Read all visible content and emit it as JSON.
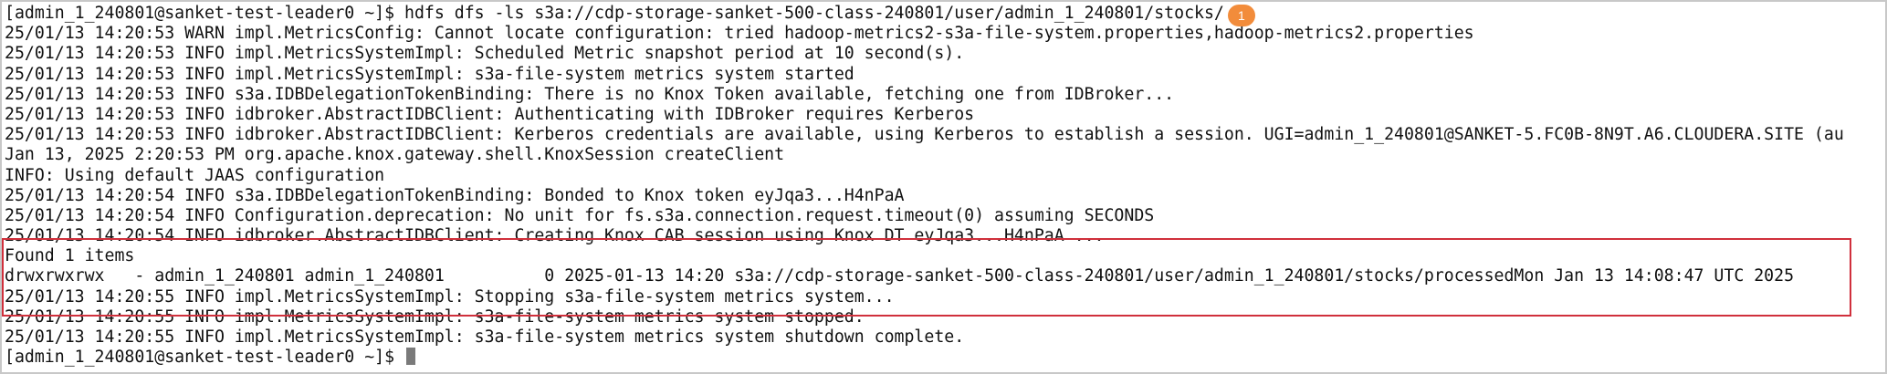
{
  "terminal": {
    "command_prompt": "[admin_1_240801@sanket-test-leader0 ~]$ ",
    "command": "hdfs dfs -ls s3a://cdp-storage-sanket-500-class-240801/user/admin_1_240801/stocks/",
    "badge": "1",
    "lines": [
      "25/01/13 14:20:53 WARN impl.MetricsConfig: Cannot locate configuration: tried hadoop-metrics2-s3a-file-system.properties,hadoop-metrics2.properties",
      "25/01/13 14:20:53 INFO impl.MetricsSystemImpl: Scheduled Metric snapshot period at 10 second(s).",
      "25/01/13 14:20:53 INFO impl.MetricsSystemImpl: s3a-file-system metrics system started",
      "25/01/13 14:20:53 INFO s3a.IDBDelegationTokenBinding: There is no Knox Token available, fetching one from IDBroker...",
      "25/01/13 14:20:53 INFO idbroker.AbstractIDBClient: Authenticating with IDBroker requires Kerberos",
      "25/01/13 14:20:53 INFO idbroker.AbstractIDBClient: Kerberos credentials are available, using Kerberos to establish a session. UGI=admin_1_240801@SANKET-5.FC0B-8N9T.A6.CLOUDERA.SITE (au",
      "Jan 13, 2025 2:20:53 PM org.apache.knox.gateway.shell.KnoxSession createClient",
      "INFO: Using default JAAS configuration",
      "25/01/13 14:20:54 INFO s3a.IDBDelegationTokenBinding: Bonded to Knox token eyJqa3...H4nPaA",
      "25/01/13 14:20:54 INFO Configuration.deprecation: No unit for fs.s3a.connection.request.timeout(0) assuming SECONDS",
      "25/01/13 14:20:54 INFO idbroker.AbstractIDBClient: Creating Knox CAB session using Knox DT eyJqa3...H4nPaA ...",
      "Found 1 items",
      "drwxrwxrwx   - admin_1_240801 admin_1_240801          0 2025-01-13 14:20 s3a://cdp-storage-sanket-500-class-240801/user/admin_1_240801/stocks/processedMon Jan 13 14:08:47 UTC 2025",
      "25/01/13 14:20:55 INFO impl.MetricsSystemImpl: Stopping s3a-file-system metrics system...",
      "25/01/13 14:20:55 INFO impl.MetricsSystemImpl: s3a-file-system metrics system stopped.",
      "25/01/13 14:20:55 INFO impl.MetricsSystemImpl: s3a-file-system metrics system shutdown complete."
    ],
    "final_prompt": "[admin_1_240801@sanket-test-leader0 ~]$ "
  },
  "colors": {
    "text": "#111111",
    "highlight_border": "#d0303c",
    "badge": "#f28c3b",
    "cursor": "#7a7a7a"
  }
}
